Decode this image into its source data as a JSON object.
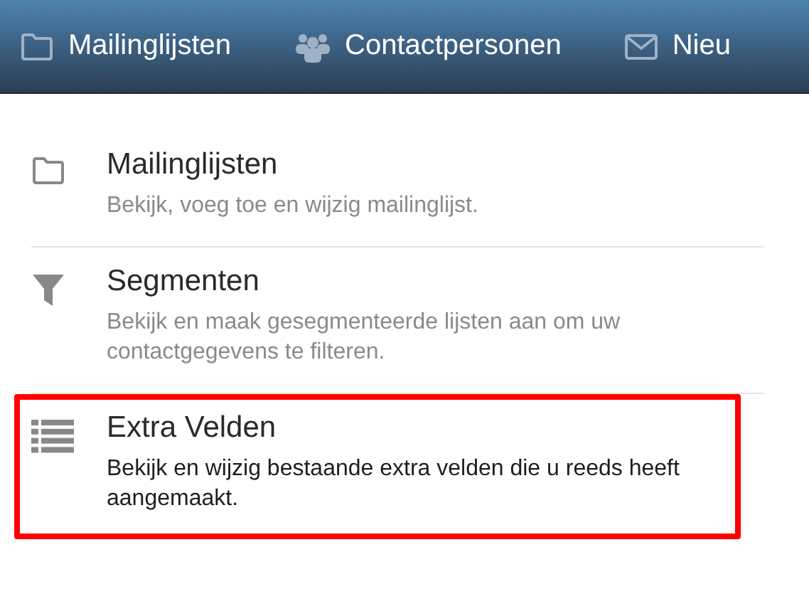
{
  "nav": [
    {
      "kind": "folder",
      "label": "Mailinglijsten"
    },
    {
      "kind": "users",
      "label": "Contactpersonen"
    },
    {
      "kind": "mail",
      "label": "Nieu"
    }
  ],
  "items": [
    {
      "kind": "folder",
      "title": "Mailinglijsten",
      "description": "Bekijk, voeg toe en wijzig mailinglijst.",
      "highlighted": false
    },
    {
      "kind": "filter",
      "title": "Segmenten",
      "description": "Bekijk en maak gesegmenteerde lijsten aan om uw contactgegevens te filteren.",
      "highlighted": false
    },
    {
      "kind": "list",
      "title": "Extra Velden",
      "description": "Bekijk en wijzig bestaande extra velden die u reeds heeft aangemaakt.",
      "highlighted": true
    }
  ]
}
